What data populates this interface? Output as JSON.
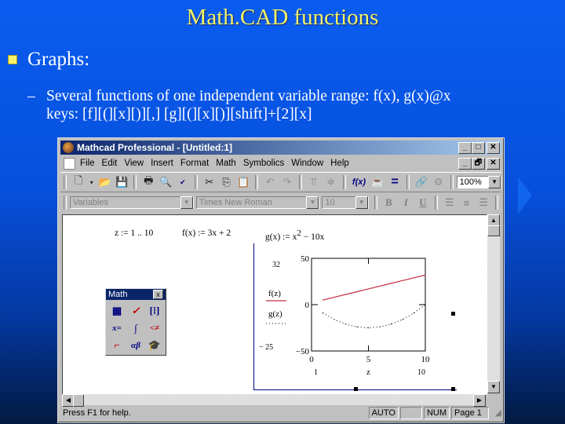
{
  "slide": {
    "title": "Math.CAD functions",
    "bullet": "Graphs:",
    "sub_dash": "–",
    "sub_line1": "Several functions of one independent variable range: f(x), g(x)@x",
    "sub_line2": "keys: [f][(][x][)][,] [g][(][x][)][shift]+[2][x]"
  },
  "window": {
    "title": "Mathcad Professional - [Untitled:1]",
    "title_buttons": [
      "_",
      "□",
      "✕"
    ],
    "doc_buttons": [
      "_",
      "🗗",
      "✕"
    ],
    "menu": [
      "File",
      "Edit",
      "View",
      "Insert",
      "Format",
      "Math",
      "Symbolics",
      "Window",
      "Help"
    ],
    "menu_underline": [
      "F",
      "E",
      "V",
      "I",
      "o",
      "M",
      "S",
      "W",
      "H"
    ],
    "toolbar": {
      "icons": [
        "new-icon",
        "open-icon",
        "save-icon",
        "print-icon",
        "print-preview-icon",
        "spellcheck-icon",
        "cut-icon",
        "copy-icon",
        "paste-icon",
        "undo-icon",
        "redo-icon",
        "align-top-icon",
        "align-vertical-icon",
        "insert-function-icon",
        "insert-unit-icon",
        "calculate-icon",
        "resources-icon",
        "component-icon"
      ],
      "function_label": "f(x)",
      "zoom": "100%"
    },
    "format_bar": {
      "style": "Variables",
      "font": "Times New Roman",
      "size": "10",
      "bold": "B",
      "italic": "I",
      "underline": "U"
    },
    "worksheet": {
      "range_def": "z := 1 .. 10",
      "f_def": "f(x) := 3x + 2",
      "g_def_prefix": "g(x) := x",
      "g_def_exp": "2",
      "g_def_suffix": " − 10x"
    },
    "math_palette": {
      "title": "Math",
      "close": "x",
      "items": [
        "calculator-toolbar",
        "graph-toolbar",
        "matrix-toolbar",
        "evaluation-toolbar",
        "calculus-toolbar",
        "boolean-toolbar",
        "programming-toolbar",
        "greek-toolbar",
        "symbolic-toolbar"
      ]
    },
    "status": {
      "help": "Press F1 for help.",
      "mode": "AUTO",
      "blank": "",
      "num": "NUM",
      "page": "Page 1"
    }
  },
  "chart_data": {
    "type": "line",
    "x_label": "z",
    "x_range": [
      0,
      10
    ],
    "x_ticks": [
      "0",
      "5",
      "10"
    ],
    "x_limit_markers": {
      "low": "1",
      "high": "10"
    },
    "ylim": [
      -50,
      50
    ],
    "y_ticks": [
      "50",
      "0",
      "-50"
    ],
    "y_limit_markers": {
      "high": "32",
      "low": "-25"
    },
    "legend": [
      "f(z)",
      "g(z)"
    ],
    "series": [
      {
        "name": "f(z)",
        "style": "solid",
        "color": "#c03040",
        "x": [
          1,
          2,
          3,
          4,
          5,
          6,
          7,
          8,
          9,
          10
        ],
        "values": [
          5,
          8,
          11,
          14,
          17,
          20,
          23,
          26,
          29,
          32
        ]
      },
      {
        "name": "g(z)",
        "style": "dotted",
        "color": "#000000",
        "x": [
          1,
          2,
          3,
          4,
          5,
          6,
          7,
          8,
          9,
          10
        ],
        "values": [
          -9,
          -16,
          -21,
          -24,
          -25,
          -24,
          -21,
          -16,
          -9,
          0
        ]
      }
    ]
  }
}
